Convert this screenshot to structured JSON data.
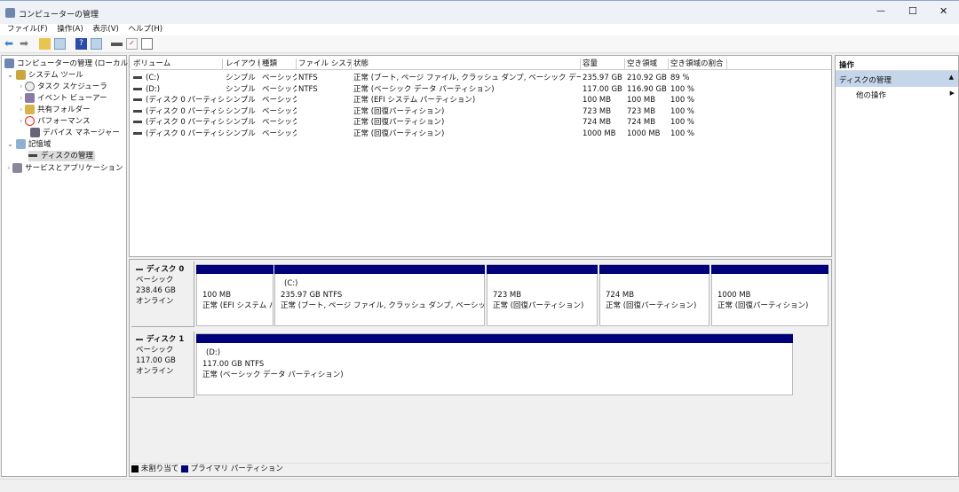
{
  "window": {
    "title": "コンピューターの管理",
    "controls": {
      "minimize": "—",
      "maximize": "☐",
      "close": "✕"
    }
  },
  "menu": [
    "ファイル(F)",
    "操作(A)",
    "表示(V)",
    "ヘルプ(H)"
  ],
  "toolbar": [
    "back-icon",
    "forward-icon",
    "up-folder-icon",
    "show-hide-tree-icon",
    "help-icon",
    "properties-icon",
    "disk-icon",
    "check-icon",
    "list-icon"
  ],
  "tree": {
    "root": "コンピューターの管理 (ローカル)",
    "items": [
      {
        "label": "システム ツール",
        "level": 1,
        "expanded": true
      },
      {
        "label": "タスク スケジューラ",
        "level": 2
      },
      {
        "label": "イベント ビューアー",
        "level": 2
      },
      {
        "label": "共有フォルダー",
        "level": 2
      },
      {
        "label": "パフォーマンス",
        "level": 2
      },
      {
        "label": "デバイス マネージャー",
        "level": 2
      },
      {
        "label": "記憶域",
        "level": 1,
        "expanded": true
      },
      {
        "label": "ディスクの管理",
        "level": 2,
        "selected": true
      },
      {
        "label": "サービスとアプリケーション",
        "level": 1
      }
    ]
  },
  "volume_list": {
    "columns": [
      "ボリューム",
      "レイアウト",
      "種類",
      "ファイル システム",
      "状態",
      "容量",
      "空き領域",
      "空き領域の割合"
    ],
    "rows": [
      [
        "(C:)",
        "シンプル",
        "ベーシック",
        "NTFS",
        "正常 (ブート, ページ ファイル, クラッシュ ダンプ, ベーシック データ パーティション)",
        "235.97 GB",
        "210.92 GB",
        "89 %"
      ],
      [
        "(D:)",
        "シンプル",
        "ベーシック",
        "NTFS",
        "正常 (ベーシック データ パーティション)",
        "117.00 GB",
        "116.90 GB",
        "100 %"
      ],
      [
        "(ディスク 0 パーティション 1)",
        "シンプル",
        "ベーシック",
        "",
        "正常 (EFI システム パーティション)",
        "100 MB",
        "100 MB",
        "100 %"
      ],
      [
        "(ディスク 0 パーティション 4)",
        "シンプル",
        "ベーシック",
        "",
        "正常 (回復パーティション)",
        "723 MB",
        "723 MB",
        "100 %"
      ],
      [
        "(ディスク 0 パーティション 5)",
        "シンプル",
        "ベーシック",
        "",
        "正常 (回復パーティション)",
        "724 MB",
        "724 MB",
        "100 %"
      ],
      [
        "(ディスク 0 パーティション 6)",
        "シンプル",
        "ベーシック",
        "",
        "正常 (回復パーティション)",
        "1000 MB",
        "1000 MB",
        "100 %"
      ]
    ]
  },
  "disks": [
    {
      "name": "ディスク 0",
      "type": "ベーシック",
      "size": "238.46 GB",
      "status": "オンライン",
      "partitions": [
        {
          "letter": "",
          "size": "100 MB",
          "status": "正常 (EFI システム パー"
        },
        {
          "letter": "(C:)",
          "size": "235.97 GB NTFS",
          "status": "正常 (ブート, ページ ファイル, クラッシュ ダンプ, ベーシック データ パーティ"
        },
        {
          "letter": "",
          "size": "723 MB",
          "status": "正常 (回復パーティション)"
        },
        {
          "letter": "",
          "size": "724 MB",
          "status": "正常 (回復パーティション)"
        },
        {
          "letter": "",
          "size": "1000 MB",
          "status": "正常 (回復パーティション)"
        }
      ]
    },
    {
      "name": "ディスク 1",
      "type": "ベーシック",
      "size": "117.00 GB",
      "status": "オンライン",
      "partitions": [
        {
          "letter": "(D:)",
          "size": "117.00 GB NTFS",
          "status": "正常 (ベーシック データ パーティション)"
        }
      ]
    }
  ],
  "legend": [
    {
      "label": "未割り当て",
      "color": "#000000"
    },
    {
      "label": "プライマリ パーティション",
      "color": "#00007a"
    }
  ],
  "actions": {
    "header": "操作",
    "section": "ディスクの管理",
    "item": "他の操作"
  },
  "colors": {
    "partition_bar": "#00007a",
    "actions_section": "#c5d5ea",
    "selected_tree": "#dcdcdc"
  }
}
